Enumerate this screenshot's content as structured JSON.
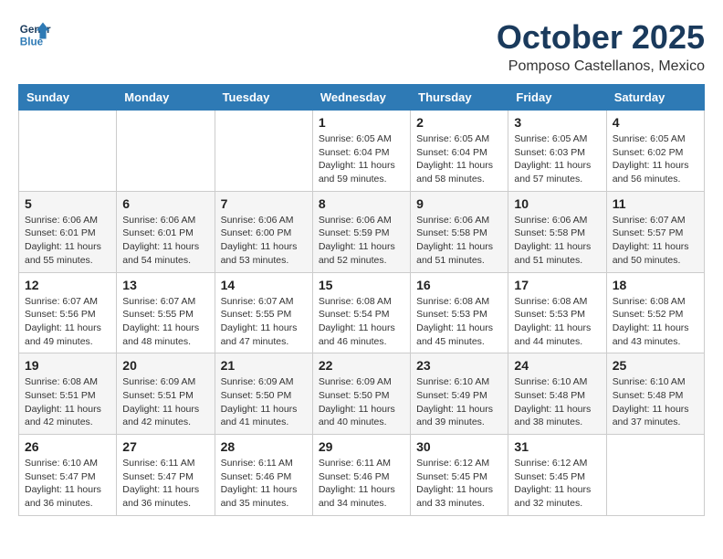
{
  "header": {
    "logo_line1": "General",
    "logo_line2": "Blue",
    "month": "October 2025",
    "location": "Pomposo Castellanos, Mexico"
  },
  "weekdays": [
    "Sunday",
    "Monday",
    "Tuesday",
    "Wednesday",
    "Thursday",
    "Friday",
    "Saturday"
  ],
  "weeks": [
    [
      {
        "day": "",
        "info": ""
      },
      {
        "day": "",
        "info": ""
      },
      {
        "day": "",
        "info": ""
      },
      {
        "day": "1",
        "info": "Sunrise: 6:05 AM\nSunset: 6:04 PM\nDaylight: 11 hours\nand 59 minutes."
      },
      {
        "day": "2",
        "info": "Sunrise: 6:05 AM\nSunset: 6:04 PM\nDaylight: 11 hours\nand 58 minutes."
      },
      {
        "day": "3",
        "info": "Sunrise: 6:05 AM\nSunset: 6:03 PM\nDaylight: 11 hours\nand 57 minutes."
      },
      {
        "day": "4",
        "info": "Sunrise: 6:05 AM\nSunset: 6:02 PM\nDaylight: 11 hours\nand 56 minutes."
      }
    ],
    [
      {
        "day": "5",
        "info": "Sunrise: 6:06 AM\nSunset: 6:01 PM\nDaylight: 11 hours\nand 55 minutes."
      },
      {
        "day": "6",
        "info": "Sunrise: 6:06 AM\nSunset: 6:01 PM\nDaylight: 11 hours\nand 54 minutes."
      },
      {
        "day": "7",
        "info": "Sunrise: 6:06 AM\nSunset: 6:00 PM\nDaylight: 11 hours\nand 53 minutes."
      },
      {
        "day": "8",
        "info": "Sunrise: 6:06 AM\nSunset: 5:59 PM\nDaylight: 11 hours\nand 52 minutes."
      },
      {
        "day": "9",
        "info": "Sunrise: 6:06 AM\nSunset: 5:58 PM\nDaylight: 11 hours\nand 51 minutes."
      },
      {
        "day": "10",
        "info": "Sunrise: 6:06 AM\nSunset: 5:58 PM\nDaylight: 11 hours\nand 51 minutes."
      },
      {
        "day": "11",
        "info": "Sunrise: 6:07 AM\nSunset: 5:57 PM\nDaylight: 11 hours\nand 50 minutes."
      }
    ],
    [
      {
        "day": "12",
        "info": "Sunrise: 6:07 AM\nSunset: 5:56 PM\nDaylight: 11 hours\nand 49 minutes."
      },
      {
        "day": "13",
        "info": "Sunrise: 6:07 AM\nSunset: 5:55 PM\nDaylight: 11 hours\nand 48 minutes."
      },
      {
        "day": "14",
        "info": "Sunrise: 6:07 AM\nSunset: 5:55 PM\nDaylight: 11 hours\nand 47 minutes."
      },
      {
        "day": "15",
        "info": "Sunrise: 6:08 AM\nSunset: 5:54 PM\nDaylight: 11 hours\nand 46 minutes."
      },
      {
        "day": "16",
        "info": "Sunrise: 6:08 AM\nSunset: 5:53 PM\nDaylight: 11 hours\nand 45 minutes."
      },
      {
        "day": "17",
        "info": "Sunrise: 6:08 AM\nSunset: 5:53 PM\nDaylight: 11 hours\nand 44 minutes."
      },
      {
        "day": "18",
        "info": "Sunrise: 6:08 AM\nSunset: 5:52 PM\nDaylight: 11 hours\nand 43 minutes."
      }
    ],
    [
      {
        "day": "19",
        "info": "Sunrise: 6:08 AM\nSunset: 5:51 PM\nDaylight: 11 hours\nand 42 minutes."
      },
      {
        "day": "20",
        "info": "Sunrise: 6:09 AM\nSunset: 5:51 PM\nDaylight: 11 hours\nand 42 minutes."
      },
      {
        "day": "21",
        "info": "Sunrise: 6:09 AM\nSunset: 5:50 PM\nDaylight: 11 hours\nand 41 minutes."
      },
      {
        "day": "22",
        "info": "Sunrise: 6:09 AM\nSunset: 5:50 PM\nDaylight: 11 hours\nand 40 minutes."
      },
      {
        "day": "23",
        "info": "Sunrise: 6:10 AM\nSunset: 5:49 PM\nDaylight: 11 hours\nand 39 minutes."
      },
      {
        "day": "24",
        "info": "Sunrise: 6:10 AM\nSunset: 5:48 PM\nDaylight: 11 hours\nand 38 minutes."
      },
      {
        "day": "25",
        "info": "Sunrise: 6:10 AM\nSunset: 5:48 PM\nDaylight: 11 hours\nand 37 minutes."
      }
    ],
    [
      {
        "day": "26",
        "info": "Sunrise: 6:10 AM\nSunset: 5:47 PM\nDaylight: 11 hours\nand 36 minutes."
      },
      {
        "day": "27",
        "info": "Sunrise: 6:11 AM\nSunset: 5:47 PM\nDaylight: 11 hours\nand 36 minutes."
      },
      {
        "day": "28",
        "info": "Sunrise: 6:11 AM\nSunset: 5:46 PM\nDaylight: 11 hours\nand 35 minutes."
      },
      {
        "day": "29",
        "info": "Sunrise: 6:11 AM\nSunset: 5:46 PM\nDaylight: 11 hours\nand 34 minutes."
      },
      {
        "day": "30",
        "info": "Sunrise: 6:12 AM\nSunset: 5:45 PM\nDaylight: 11 hours\nand 33 minutes."
      },
      {
        "day": "31",
        "info": "Sunrise: 6:12 AM\nSunset: 5:45 PM\nDaylight: 11 hours\nand 32 minutes."
      },
      {
        "day": "",
        "info": ""
      }
    ]
  ]
}
